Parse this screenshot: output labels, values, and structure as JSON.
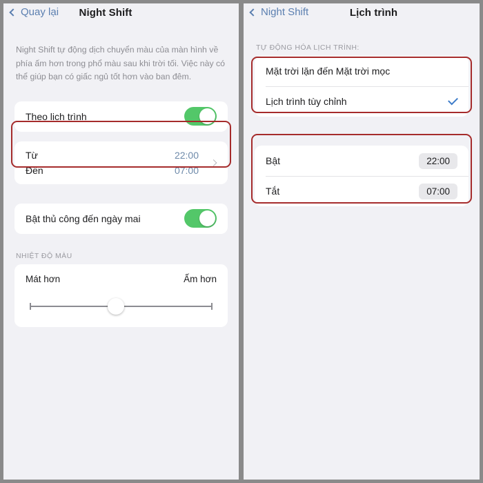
{
  "left": {
    "nav": {
      "back_label": "Quay lại",
      "title": "Night Shift",
      "back_icon": "chevron-left-icon"
    },
    "description": "Night Shift tự động dịch chuyển màu của màn hình về phía ấm hơn trong phổ màu sau khi trời tối. Việc này có thể giúp bạn có giấc ngủ tốt hơn vào ban đêm.",
    "scheduled_row": {
      "label": "Theo lịch trình",
      "toggle_on": true
    },
    "time_row": {
      "from_label": "Từ",
      "from_value": "22:00",
      "to_label": "Đến",
      "to_value": "07:00",
      "chevron_icon": "chevron-right-icon"
    },
    "manual_row": {
      "label": "Bật thủ công đến ngày mai",
      "toggle_on": true
    },
    "temperature": {
      "section_label": "NHIỆT ĐỘ MÀU",
      "cooler_label": "Mát hơn",
      "warmer_label": "Ấm hơn",
      "slider_value_percent": 47
    }
  },
  "right": {
    "nav": {
      "back_label": "Night Shift",
      "title": "Lịch trình",
      "back_icon": "chevron-left-icon"
    },
    "automation": {
      "section_label": "TỰ ĐỘNG HÓA LỊCH TRÌNH:",
      "options": [
        {
          "label": "Mặt trời lặn đến Mặt trời mọc",
          "selected": false
        },
        {
          "label": "Lịch trình tùy chỉnh",
          "selected": true
        }
      ],
      "check_icon": "checkmark-icon"
    },
    "times": [
      {
        "label": "Bật",
        "value": "22:00"
      },
      {
        "label": "Tắt",
        "value": "07:00"
      }
    ]
  },
  "colors": {
    "accent_blue": "#5b7fb0",
    "toggle_green": "#53c769",
    "annotation_red": "#a52b2b",
    "check_blue": "#3d7cc9",
    "panel_bg": "#f1f1f5",
    "frame_gray": "#8a8a8a"
  }
}
